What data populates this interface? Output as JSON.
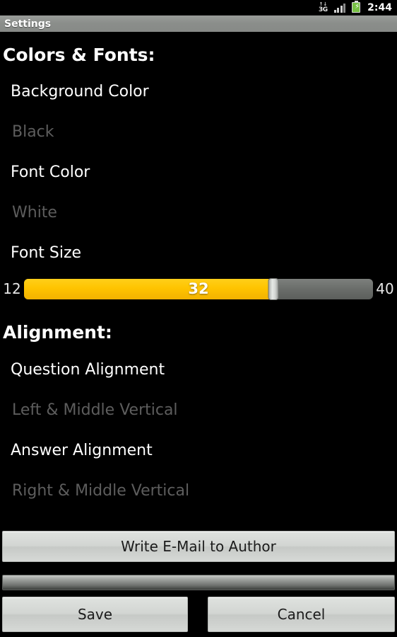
{
  "status_bar": {
    "network_icon": "3g-data-icon",
    "network_label": "3G",
    "data_arrows": "↑↓",
    "signal_icon": "signal-bars-icon",
    "battery_icon": "battery-charging-icon",
    "battery_bolt": "⚡",
    "clock": "2:44"
  },
  "title_bar": {
    "title": "Settings"
  },
  "sections": {
    "colors_fonts": {
      "header": "Colors & Fonts:",
      "background_color": {
        "label": "Background Color",
        "value": "Black"
      },
      "font_color": {
        "label": "Font Color",
        "value": "White"
      },
      "font_size": {
        "label": "Font Size",
        "min": "12",
        "max": "40",
        "value": "32"
      }
    },
    "alignment": {
      "header": "Alignment:",
      "question_alignment": {
        "label": "Question Alignment",
        "value": "Left & Middle Vertical"
      },
      "answer_alignment": {
        "label": "Answer Alignment",
        "value": "Right & Middle Vertical"
      }
    }
  },
  "buttons": {
    "email": "Write E-Mail to Author",
    "save": "Save",
    "cancel": "Cancel"
  },
  "colors": {
    "background": "#000000",
    "accent": "#ffc400",
    "title_bar": "#8b8e8b",
    "label_text": "#ffffff",
    "value_text": "#5d5d5d",
    "button_face": "#d2d5d2"
  }
}
